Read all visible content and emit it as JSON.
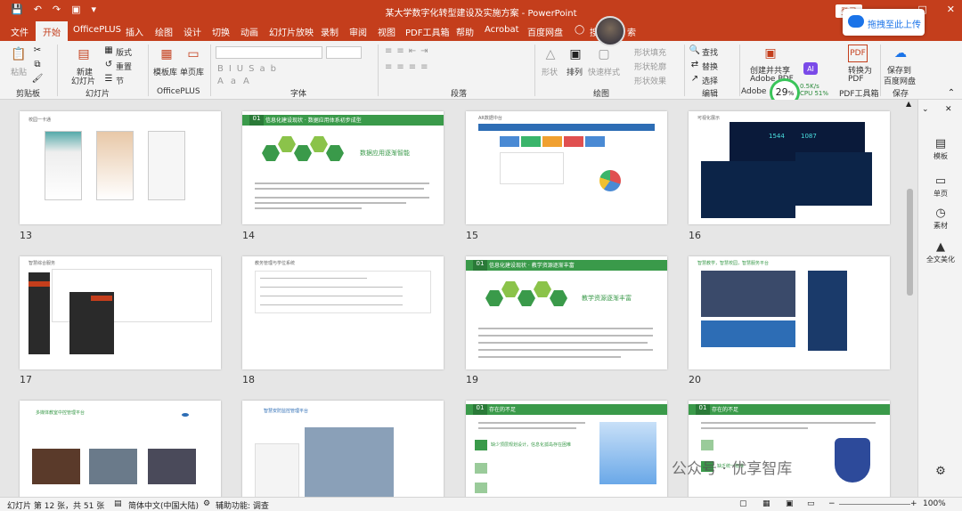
{
  "app": {
    "title": "某大学数字化转型建设及实施方案 - PowerPoint",
    "login_label": "登录",
    "upload_label": "拖拽至此上传"
  },
  "qat": {
    "save_icon": "save-icon",
    "undo_icon": "undo-icon",
    "redo_icon": "redo-icon",
    "present_icon": "present-icon"
  },
  "tabs": [
    "文件",
    "开始",
    "OfficePLUS",
    "插入",
    "绘图",
    "设计",
    "切换",
    "动画",
    "幻灯片放映",
    "录制",
    "审阅",
    "视图",
    "PDF工具箱",
    "帮助",
    "Acrobat",
    "百度网盘",
    "搜索",
    "索"
  ],
  "active_tab": "开始",
  "ribbon": {
    "clipboard": {
      "paste": "粘贴",
      "label": "剪贴板"
    },
    "slides": {
      "new_slide": "新建",
      "new_slide2": "幻灯片",
      "layout": "版式",
      "reset": "重置",
      "section": "节",
      "label": "幻灯片"
    },
    "officeplus": {
      "template": "模板库",
      "single": "单页库",
      "label": "OfficePLUS"
    },
    "font": {
      "label": "字体"
    },
    "paragraph": {
      "label": "段落"
    },
    "drawing": {
      "shape": "形状",
      "arrange": "排列",
      "quick_style": "快速样式",
      "fill": "形状填充",
      "outline": "形状轮廓",
      "effect": "形状效果",
      "label": "绘图"
    },
    "editing": {
      "find": "查找",
      "replace": "替换",
      "select": "选择",
      "label": "编辑"
    },
    "adobe": {
      "create_share": "创建并共享",
      "adobe_pdf": "Adobe PDF",
      "label": "Adobe"
    },
    "pdf_tool": {
      "convert": "转换为",
      "pdf": "PDF",
      "label": "PDF工具箱"
    },
    "save": {
      "save_to": "保存到",
      "baidu": "百度网盘",
      "label": "保存"
    }
  },
  "perf": {
    "value": "29",
    "unit": "%",
    "net": "0.5K/s",
    "cpu": "CPU 51%"
  },
  "slides": [
    {
      "num": "13",
      "title": "校园一卡通"
    },
    {
      "num": "14",
      "badge": "01",
      "bar": "信息化建设现状 · 数据应用体系初步成型",
      "heading": "数据应用逐渐智能"
    },
    {
      "num": "15",
      "title": "AR数据中台"
    },
    {
      "num": "16",
      "title": "可视化展示",
      "stat1": "1544",
      "stat2": "1087"
    },
    {
      "num": "17",
      "title": "智慧综合服务"
    },
    {
      "num": "18",
      "title": "教务管理与学位系统"
    },
    {
      "num": "19",
      "badge": "01",
      "bar": "信息化建设现状 · 教学资源逐渐丰富",
      "heading": "教学资源逐渐丰富"
    },
    {
      "num": "20",
      "title": "智慧教学，智慧校园，智慧服务平台"
    },
    {
      "num": "",
      "title": "多媒体教室中控管理平台"
    },
    {
      "num": "",
      "title": "智慧安防监控管理平台"
    },
    {
      "num": "",
      "badge": "01",
      "bar": "存在的不足",
      "heading": "缺少顶层规划设计，信息化孤岛存在困难"
    },
    {
      "num": "",
      "badge": "01",
      "bar": "存在的不足",
      "heading": "缺乏统一标准"
    }
  ],
  "side_panel": {
    "templates": "模板",
    "single": "单页",
    "material": "素材",
    "beautify": "全文美化"
  },
  "status": {
    "slide_info": "幻灯片 第 12 张，共 51 张",
    "lang": "简体中文(中国大陆)",
    "access": "辅助功能: 调查",
    "zoom": "100%"
  },
  "watermark": "公众号 · 优享智库",
  "colors": {
    "accent": "#c43e1c",
    "green": "#3a9a4a",
    "blue": "#1a73e8"
  }
}
